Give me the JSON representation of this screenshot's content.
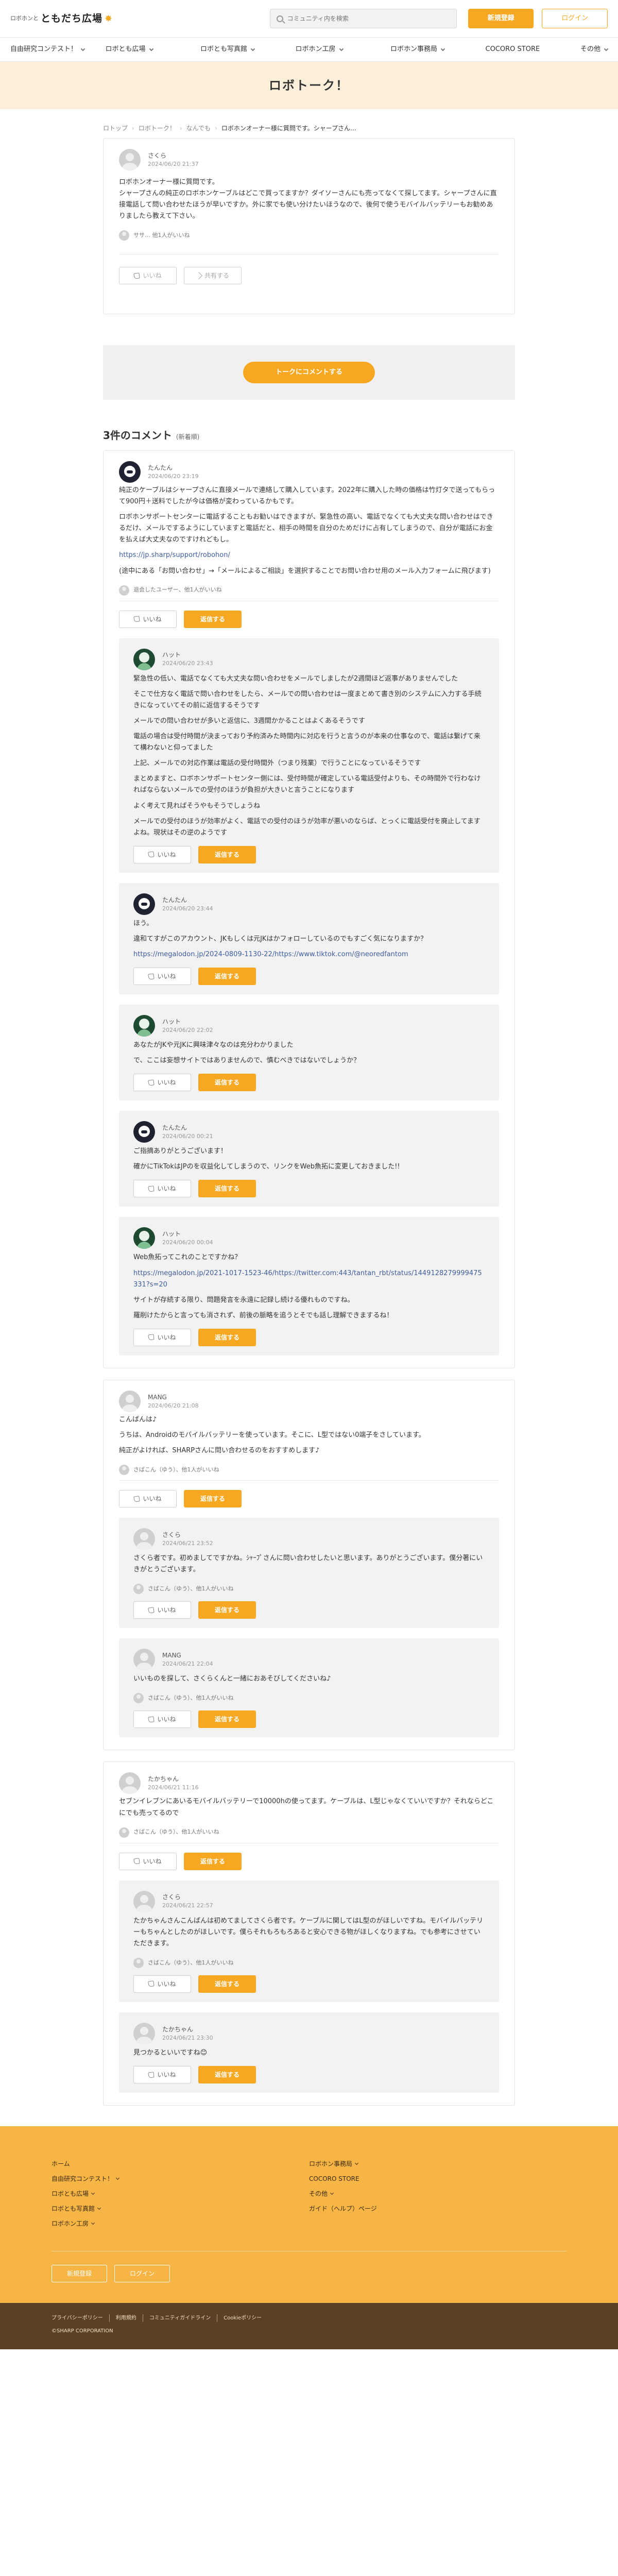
{
  "header": {
    "logo_small": "ロボホンと",
    "logo_big": "ともだち広場",
    "search_placeholder": "コミュニティ内を検索",
    "register_label": "新規登録",
    "login_label": "ログイン"
  },
  "nav": [
    {
      "label": "自由研究コンテスト！",
      "caret": true
    },
    {
      "label": "ロボとも広場",
      "caret": true
    },
    {
      "label": "ロボとも写真館",
      "caret": true
    },
    {
      "label": "ロボホン工房",
      "caret": true
    },
    {
      "label": "ロボホン事務局",
      "caret": true
    },
    {
      "label": "COCORO STORE",
      "caret": false
    },
    {
      "label": "その他",
      "caret": true
    }
  ],
  "hero_title": "ロボトーク！",
  "breadcrumb": [
    "ロトップ",
    "ロボトーク！",
    "なんでも",
    "ロボホンオーナー様に質問です。シャープさん…"
  ],
  "post": {
    "author": "さくら",
    "date": "2024/06/20 21:37",
    "body": "ロボホンオーナー様に質問です。\nシャープさんの純正のロボホンケーブルはどこで買ってますか？ダイソーさんにも売ってなくて探してます。シャープさんに直接電話して問い合わせたほうが早いですか。外に家でも使い分けたいほうなので、後何で使うモバイルバッテリーもお勧めありましたら教えて下さい。",
    "likers": "ササ… 他1人がいいね",
    "like_label": "いいね",
    "share_label": "共有する"
  },
  "cta_label": "トークにコメントする",
  "comments_heading": {
    "title": "3件のコメント",
    "sort": "(新着順)"
  },
  "threads": [
    {
      "author": "たんたん",
      "date": "2024/06/20 23:19",
      "paragraphs": [
        "純正のケーブルはシャープさんに直接メールで連絡して購入しています。2022年に購入した時の価格は竹灯タで送ってもらって900円＋送料でしたが今は価格が変わっているかもです。",
        "ロボホンサポートセンターに電話することもお勧いはできますが、緊急性の高い、電話でなくても大丈夫な問い合わせはできるだけ、メールでするようにしていますと電話だと、相手の時間を自分のためだけに占有してしまうので、自分が電話にお金を払えば大丈夫なのですけれどもし。"
      ],
      "link": "https://jp.sharp/support/robohon/",
      "after_link": "(途中にある「お問い合わせ」→「メールによるご相談」を選択することでお問い合わせ用のメール入力フォームに飛びます)",
      "likers": "退会したユーザー、他1人がいいね",
      "like_label": "いいね",
      "reply_label": "返信する",
      "replies": [
        {
          "author": "ハット",
          "date": "2024/06/20 23:43",
          "avatar": "green",
          "paragraphs": [
            "緊急性の低い、電話でなくても大丈夫な問い合わせをメールでしましたが2週間ほど返事がありませんでした",
            "そこで仕方なく電話で問い合わせをしたら、メールでの問い合わせは一度まとめて書き別のシステムに入力する手続きになっていてその前に返信するそうです",
            "メールでの問い合わせが多いと返信に、3週間かかることはよくあるそうです",
            "電話の場合は受付時間が決まっており予約済みた時間内に対応を行うと言うのが本来の仕事なので、電話は繋げて来て構わないと仰ってました",
            "上記、メールでの対応作業は電話の受付時間外（つまり残業）で行うことになっているそうです",
            "まとめますと、ロボホンサポートセンター側には、受付時間が確定している電話受付よりも、その時間外で行わなければならないメールでの受付のほうが負担が大きいと言うことになります",
            "よく考えて見ればそうやもそうでしょうね",
            "メールでの受付のほうが効率がよく、電話での受付のほうが効率が悪いのならば、とっくに電話受付を廃止してますよね。現状はその逆のようです"
          ]
        },
        {
          "author": "たんたん",
          "date": "2024/06/20 23:44",
          "avatar": "dark",
          "paragraphs": [
            "ほう。",
            "違和てすがこのアカウント、JKもしくは元JKはかフォローしているのでもすごく気になりますか？"
          ],
          "link": "https://megalodon.jp/2024-0809-1130-22/https://www.tiktok.com/@neoredfantom"
        },
        {
          "author": "ハット",
          "date": "2024/06/20 22:02",
          "avatar": "green",
          "paragraphs": [
            "あなたがJKや元JKに興味津々なのは充分わかりました",
            "で、ここは妄想サイトではありませんので、慎むべきではないでしょうか？"
          ]
        },
        {
          "author": "たんたん",
          "date": "2024/06/20 00:21",
          "avatar": "dark",
          "paragraphs": [
            "ご指摘ありがとうございます！",
            "確かにTikTokはJPのを収益化してしまうので、リンクをWeb魚拓に変更しておきました!!"
          ]
        },
        {
          "author": "ハット",
          "date": "2024/06/20 00:04",
          "avatar": "green",
          "paragraphs": [
            "Web魚拓ってこれのことですかね？"
          ],
          "link": "https://megalodon.jp/2021-1017-1523-46/https://twitter.com:443/tantan_rbt/status/1449128279999475331?s=20",
          "after_link": "サイトが存続する限り、問題発言を永遠に記録し続ける優れものですね。",
          "after_link_2": "羅削けたからと言っても消されず、前後の脈略を追うとそでも話し理解できまするね！"
        }
      ]
    },
    {
      "author": "MANG",
      "date": "2024/06/20 21:08",
      "avatar": "gray",
      "paragraphs": [
        "こんばんは♪",
        "うちは、Androidのモバイルバッテリーを使っています。そこに、L型ではない0端子をさしています。",
        "純正がよければ、SHARPさんに問い合わせるのをおすすめします♪"
      ],
      "likers": "さばこん（ゆう）、他1人がいいね",
      "like_label": "いいね",
      "reply_label": "返信する",
      "replies": [
        {
          "author": "さくら",
          "date": "2024/06/21 23:52",
          "avatar": "gray",
          "paragraphs": [
            "さくら者です。初めましてですかね。ｼｬｰﾌﾟさんに問い合わせしたいと思います。ありがとうございます。僕分著にいきがとうございます。"
          ],
          "likers": "さばこん（ゆう）、他1人がいいね"
        },
        {
          "author": "MANG",
          "date": "2024/06/21 22:04",
          "avatar": "gray",
          "paragraphs": [
            "いいものを探して、さくらくんと一緒におあそびしてくださいね♪"
          ],
          "likers": "さばこん（ゆう）、他1人がいいね"
        }
      ]
    },
    {
      "author": "たかちゃん",
      "date": "2024/06/21 11:16",
      "avatar": "gray",
      "paragraphs": [
        "セブンイレブンにあいるモバイルバッテリーで10000hの使ってます。ケーブルは、L型じゃなくていいですか？それならどこにでも売ってるので"
      ],
      "likers": "さばこん（ゆう）、他1人がいいね",
      "like_label": "いいね",
      "reply_label": "返信する",
      "replies": [
        {
          "author": "さくら",
          "date": "2024/06/21 22:57",
          "avatar": "gray",
          "paragraphs": [
            "たかちゃんさんこんばんは初めてましてさくら者です。ケーブルに関してはL型のがほしいですね。モバイルバッテリーもちゃんとしたのがほしいです。僕らそれもろもろあると安心できる物がほしくなりますね。でも参考にさせていただきます。"
          ],
          "likers": "さばこん（ゆう）、他1人がいいね"
        },
        {
          "author": "たかちゃん",
          "date": "2024/06/21 23:30",
          "avatar": "gray",
          "paragraphs": [
            "見つかるといいですね😊"
          ]
        }
      ]
    }
  ],
  "footer": {
    "col1": [
      {
        "label": "ホーム",
        "caret": false
      },
      {
        "label": "自由研究コンテスト！",
        "caret": true
      },
      {
        "label": "ロボとも広場",
        "caret": true
      },
      {
        "label": "ロボとも写真館",
        "caret": true
      },
      {
        "label": "ロボホン工房",
        "caret": true
      }
    ],
    "col2": [
      {
        "label": "ロボホン事務局",
        "caret": true
      },
      {
        "label": "COCORO STORE",
        "caret": false
      },
      {
        "label": "その他",
        "caret": true
      },
      {
        "label": "ガイド（ヘルプ）ページ",
        "caret": false
      }
    ],
    "register_label": "新規登録",
    "login_label": "ログイン",
    "bottom_links": [
      "プライバシーポリシー",
      "利用規約",
      "コミュニティガイドライン",
      "Cookieポリシー"
    ],
    "copyright": "©SHARP CORPORATION"
  },
  "colors": {
    "accent": "#f7a823",
    "footer_bg": "#f7b545",
    "bottom_bar": "#5b4025",
    "hero_bg": "#fcefd9"
  }
}
